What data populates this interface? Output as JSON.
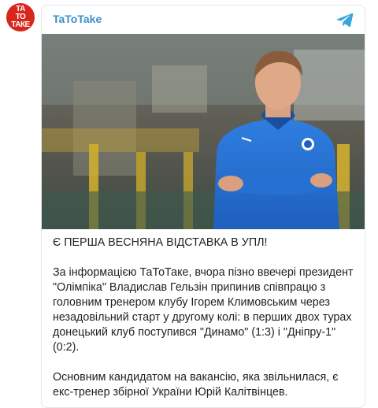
{
  "avatar": {
    "text": "ТА\nТО\nТАКЕ",
    "color": "#d8261d"
  },
  "header": {
    "channel_name": "TaToTake",
    "icon": "telegram-icon",
    "accent": "#3a8ec6"
  },
  "photo": {
    "description_icon": "coach-photo"
  },
  "post": {
    "headline": "Є ПЕРША ВЕСНЯНА ВІДСТАВКА В УПЛ!",
    "paragraph1": "За інформацією ТаТоТаке, вчора пізно ввечері президент \"Олімпіка\" Владислав Гельзін припинив співпрацю з головним тренером клубу Ігорем Климовським через незадовільний старт у другому колі: в перших двох турах донецький клуб поступився \"Динамо\" (1:3) і \"Дніпру-1\" (0:2).",
    "paragraph2": "Основним кандидатом на вакансію, яка звільнилася, є екс-тренер збірної України Юрій Калітвінцев."
  }
}
